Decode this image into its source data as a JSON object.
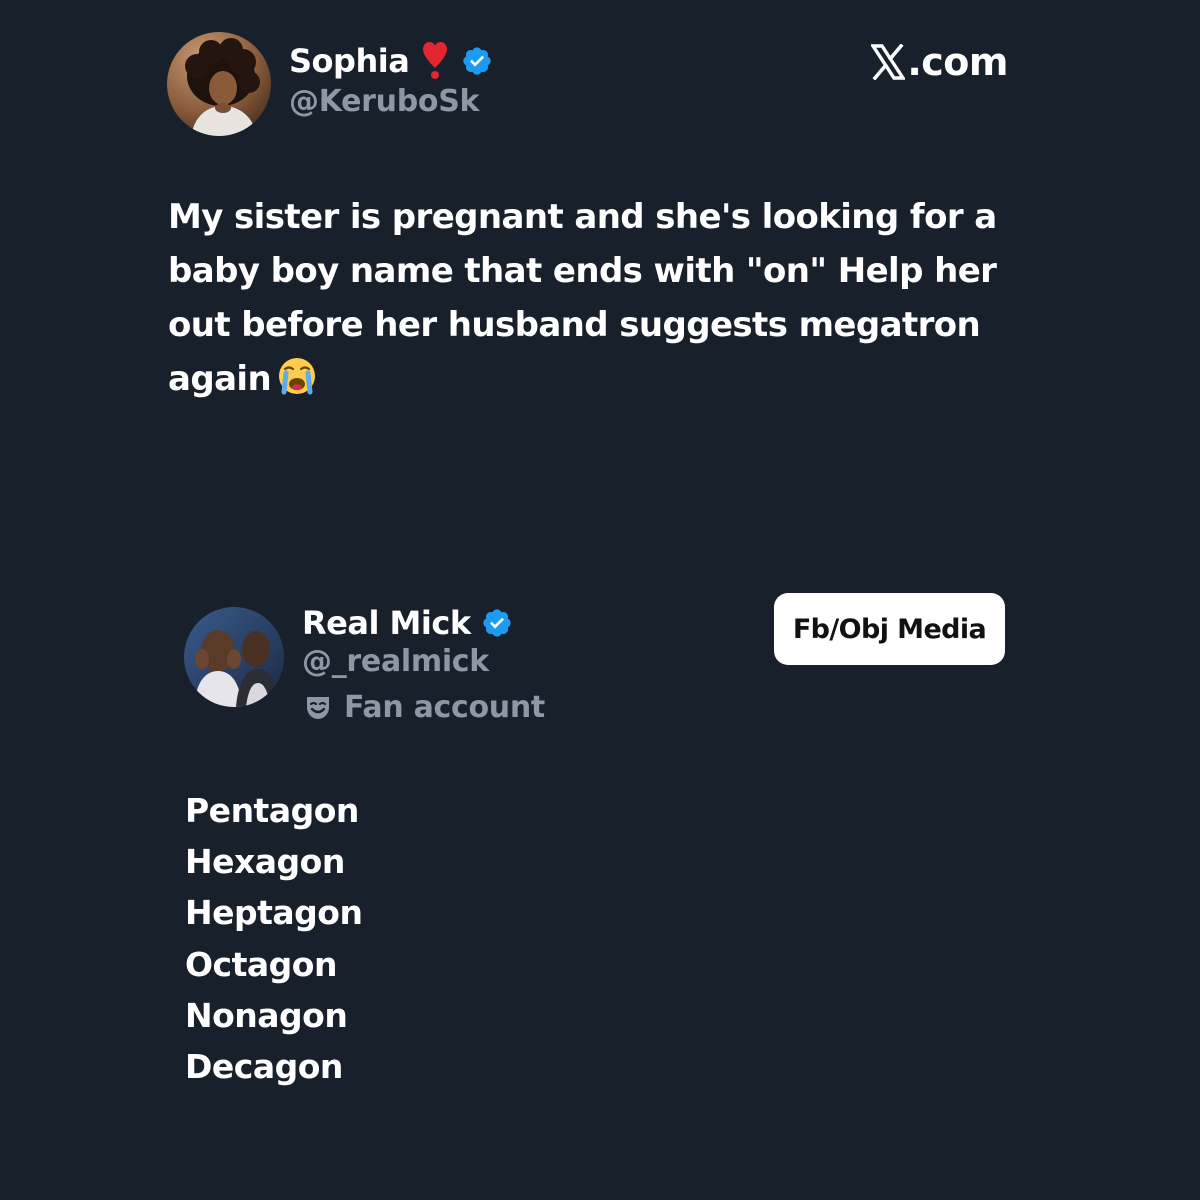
{
  "colors": {
    "background": "#18202b",
    "text_primary": "#ffffff",
    "text_secondary": "#8b98a5",
    "verified_blue": "#1d9bf0",
    "heart_red": "#e3262f",
    "watermark_bg": "#ffffff",
    "watermark_text": "#111111"
  },
  "header": {
    "brand": ".com",
    "brand_icon": "x-logo-icon"
  },
  "tweet1": {
    "display_name": "Sophia",
    "name_icons": [
      "heart-exclamation-icon",
      "verified-badge-icon"
    ],
    "handle": "@KeruboSk",
    "text": "My sister is pregnant and she's looking for a baby boy name that ends with \"on\" Help her out before her husband suggests megatron again",
    "text_emoji": "loudly-crying-face-icon"
  },
  "tweet2": {
    "display_name": "Real Mick",
    "name_icons": [
      "verified-badge-icon"
    ],
    "handle": "@_realmick",
    "label_icon": "mask-icon",
    "label": "Fan account",
    "watermark": "Fb/Obj Media",
    "answers": [
      "Pentagon",
      "Hexagon",
      "Heptagon",
      "Octagon",
      "Nonagon",
      "Decagon"
    ]
  }
}
